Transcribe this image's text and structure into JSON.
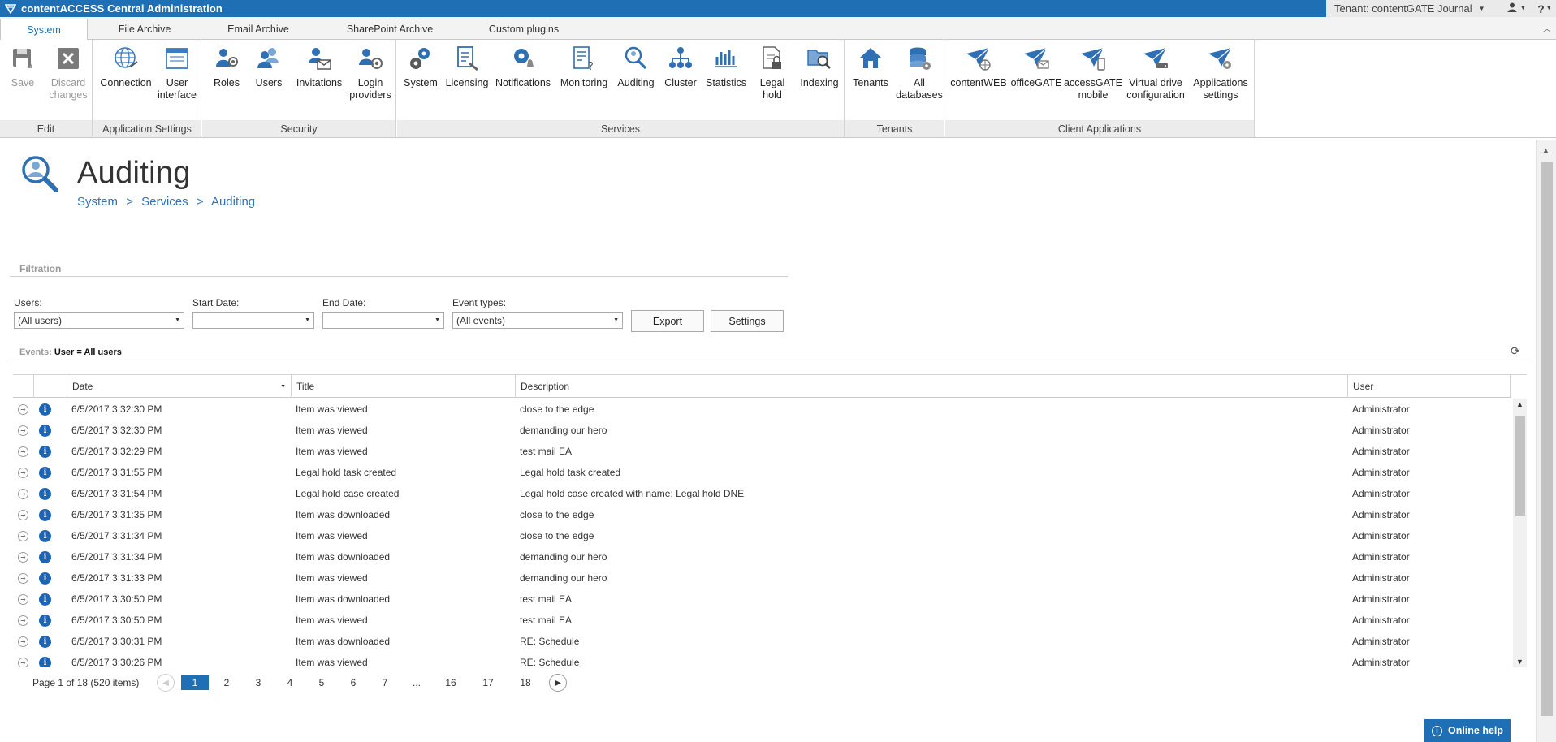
{
  "app": {
    "title": "contentACCESS Central Administration",
    "tenant_label": "Tenant: contentGATE Journal",
    "help_glyph": "?"
  },
  "tabs": [
    {
      "label": "System",
      "active": true
    },
    {
      "label": "File Archive"
    },
    {
      "label": "Email Archive"
    },
    {
      "label": "SharePoint Archive"
    },
    {
      "label": "Custom plugins"
    }
  ],
  "ribbon": {
    "groups": {
      "edit": "Edit",
      "app_settings": "Application Settings",
      "security": "Security",
      "services": "Services",
      "tenants": "Tenants",
      "client_apps": "Client Applications"
    },
    "buttons": {
      "save": "Save",
      "discard": "Discard changes",
      "connection": "Connection",
      "user_interface": "User interface",
      "roles": "Roles",
      "users": "Users",
      "invitations": "Invitations",
      "login_providers": "Login providers",
      "system": "System",
      "licensing": "Licensing",
      "notifications": "Notifications",
      "monitoring": "Monitoring",
      "auditing": "Auditing",
      "cluster": "Cluster",
      "statistics": "Statistics",
      "legal_hold": "Legal hold",
      "indexing": "Indexing",
      "tenants": "Tenants",
      "all_databases": "All databases",
      "contentweb": "contentWEB",
      "officegate": "officeGATE",
      "accessgate_mobile": "accessGATE mobile",
      "virtual_drive": "Virtual drive configuration",
      "app_settings": "Applications settings"
    }
  },
  "page": {
    "title": "Auditing",
    "breadcrumb": [
      "System",
      ">",
      "Services",
      ">",
      "Auditing"
    ]
  },
  "filtration": {
    "title": "Filtration",
    "users_label": "Users:",
    "users_value": "(All users)",
    "start_label": "Start Date:",
    "start_value": "",
    "end_label": "End Date:",
    "end_value": "",
    "event_types_label": "Event types:",
    "event_types_value": "(All events)",
    "export": "Export",
    "settings": "Settings"
  },
  "events": {
    "label": "Events:",
    "filter": "User = All users"
  },
  "grid": {
    "columns": {
      "date": "Date",
      "title": "Title",
      "description": "Description",
      "user": "User"
    },
    "rows": [
      {
        "date": "6/5/2017 3:32:30 PM",
        "title": "Item was viewed",
        "description": "close to the edge",
        "user": "Administrator"
      },
      {
        "date": "6/5/2017 3:32:30 PM",
        "title": "Item was viewed",
        "description": "demanding our hero",
        "user": "Administrator"
      },
      {
        "date": "6/5/2017 3:32:29 PM",
        "title": "Item was viewed",
        "description": "test mail EA",
        "user": "Administrator"
      },
      {
        "date": "6/5/2017 3:31:55 PM",
        "title": "Legal hold task created",
        "description": "Legal hold task created",
        "user": "Administrator"
      },
      {
        "date": "6/5/2017 3:31:54 PM",
        "title": "Legal hold case created",
        "description": "Legal hold case created with name: Legal hold DNE",
        "user": "Administrator"
      },
      {
        "date": "6/5/2017 3:31:35 PM",
        "title": "Item was downloaded",
        "description": "close to the edge",
        "user": "Administrator"
      },
      {
        "date": "6/5/2017 3:31:34 PM",
        "title": "Item was viewed",
        "description": "close to the edge",
        "user": "Administrator"
      },
      {
        "date": "6/5/2017 3:31:34 PM",
        "title": "Item was downloaded",
        "description": "demanding our hero",
        "user": "Administrator"
      },
      {
        "date": "6/5/2017 3:31:33 PM",
        "title": "Item was viewed",
        "description": "demanding our hero",
        "user": "Administrator"
      },
      {
        "date": "6/5/2017 3:30:50 PM",
        "title": "Item was downloaded",
        "description": "test mail EA",
        "user": "Administrator"
      },
      {
        "date": "6/5/2017 3:30:50 PM",
        "title": "Item was viewed",
        "description": "test mail EA",
        "user": "Administrator"
      },
      {
        "date": "6/5/2017 3:30:31 PM",
        "title": "Item was downloaded",
        "description": "RE: Schedule",
        "user": "Administrator"
      },
      {
        "date": "6/5/2017 3:30:26 PM",
        "title": "Item was viewed",
        "description": "RE: Schedule",
        "user": "Administrator"
      }
    ]
  },
  "pager": {
    "info": "Page 1 of 18 (520 items)",
    "pages": [
      "1",
      "2",
      "3",
      "4",
      "5",
      "6",
      "7",
      "...",
      "16",
      "17",
      "18"
    ],
    "current": "1"
  },
  "online_help": "Online help",
  "colors": {
    "accent": "#1e6fb3",
    "info_icon": "#1d64b5"
  }
}
